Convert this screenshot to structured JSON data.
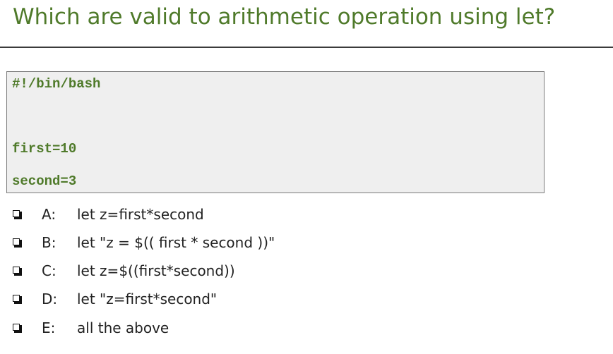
{
  "title": "Which are valid to arithmetic operation using let?",
  "code": {
    "lines": [
      "#!/bin/bash",
      "first=10",
      "second=3"
    ]
  },
  "options": [
    {
      "letter": "A:",
      "text": "let z=first*second"
    },
    {
      "letter": "B:",
      "text": "let \"z = $(( first * second ))\""
    },
    {
      "letter": "C:",
      "text": "let z=$((first*second))"
    },
    {
      "letter": "D:",
      "text": "let \"z=first*second\""
    },
    {
      "letter": "E:",
      "text": "all the above"
    }
  ],
  "colors": {
    "accent_green": "#4f7a2a",
    "code_background": "#efefef",
    "text": "#222222"
  },
  "icons": {
    "option_marker": "checkbox-icon"
  }
}
